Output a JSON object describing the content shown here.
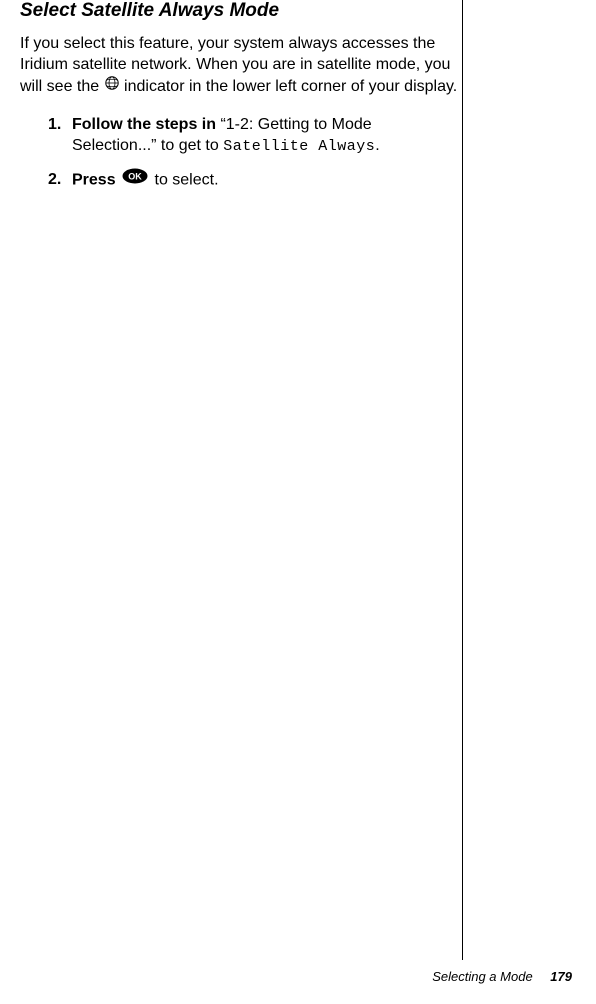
{
  "heading": "Select Satellite Always Mode",
  "intro": {
    "part1": "If you select this feature, your system always accesses the Iridium satellite network. When you are in satellite mode, you will see the ",
    "part2": " indicator in the lower left corner of your display."
  },
  "steps": [
    {
      "num": "1.",
      "bold": "Follow the steps in ",
      "plain1": "“1-2: Getting to Mode Selection...” to get to ",
      "menu": "Satellite Always",
      "plain2": "."
    },
    {
      "num": "2.",
      "bold": "Press ",
      "plain": " to select."
    }
  ],
  "footer": {
    "section": "Selecting a Mode",
    "page": "179"
  },
  "chart_data": null
}
